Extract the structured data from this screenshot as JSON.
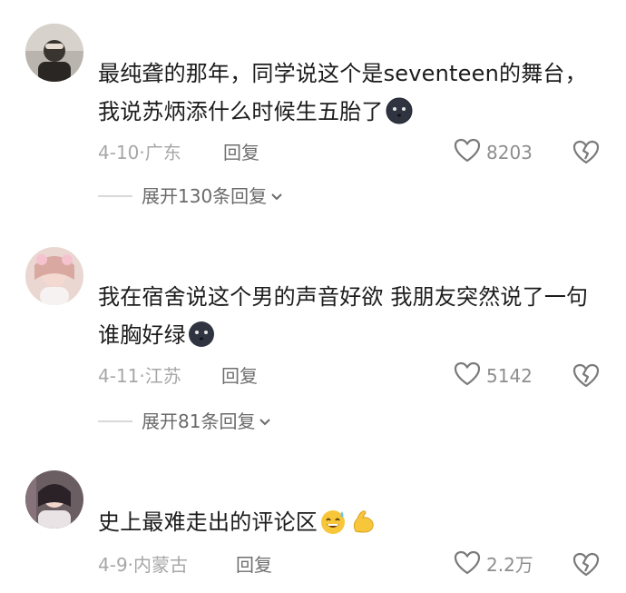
{
  "comments": [
    {
      "text": "最纯聋的那年，同学说这个是seventeen的舞台，我说苏炳添什么时候生五胎了",
      "date": "4-10",
      "location": "广东",
      "reply_label": "回复",
      "likes": "8203",
      "expand_label": "展开130条回复",
      "emoji": "dark-face-emoji"
    },
    {
      "text": "我在宿舍说这个男的声音好欲 我朋友突然说了一句谁胸好绿",
      "date": "4-11",
      "location": "江苏",
      "reply_label": "回复",
      "likes": "5142",
      "expand_label": "展开81条回复",
      "emoji": "dark-face-emoji"
    },
    {
      "text": "史上最难走出的评论区",
      "date": "4-9",
      "location": "内蒙古",
      "reply_label": "回复",
      "likes": "2.2万",
      "emoji": "laugh-sweat-emoji, flexed-biceps-emoji"
    }
  ],
  "separator": "·",
  "colors": {
    "text": "#1c1c1c",
    "meta": "#a7a7a7",
    "reply": "#6f6f6f",
    "icon": "#7a7a7a"
  }
}
